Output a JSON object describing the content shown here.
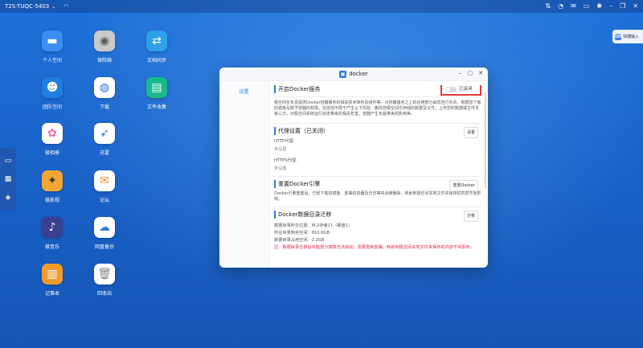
{
  "topbar": {
    "device": "T2S-TUQC-5403",
    "icons": [
      "sort-icon",
      "speed-icon",
      "mail-icon",
      "monitor-icon",
      "gear-icon",
      "minimize-icon",
      "restore-icon",
      "close-icon"
    ]
  },
  "desktop": {
    "icons": [
      {
        "label": "个人空间",
        "icon": "folder-icon",
        "color": "#3a8ff0"
      },
      {
        "label": "保险箱",
        "icon": "safe-icon",
        "color": "#c9c9c9"
      },
      {
        "label": "文档同步",
        "icon": "sync-icon",
        "color": "#2ea0e8"
      },
      {
        "label": "团队空间",
        "icon": "team-icon",
        "color": "#1f7fe0"
      },
      {
        "label": "下载",
        "icon": "globe-icon",
        "color": "#ffffff"
      },
      {
        "label": "文件收集",
        "icon": "collect-icon",
        "color": "#19b98b"
      },
      {
        "label": "极相册",
        "icon": "photos-icon",
        "color": "#ffffff"
      },
      {
        "label": "迅雷",
        "icon": "thunder-icon",
        "color": "#ffffff"
      },
      {
        "label": "极影视",
        "icon": "video-icon",
        "color": "#f2a636"
      },
      {
        "label": "论坛",
        "icon": "chat-icon",
        "color": "#ffffff"
      },
      {
        "label": "极音乐",
        "icon": "music-icon",
        "color": "#3a3f8f"
      },
      {
        "label": "网盘备份",
        "icon": "cloud-icon",
        "color": "#ffffff"
      },
      {
        "label": "记事本",
        "icon": "notes-icon",
        "color": "#f29b2f"
      },
      {
        "label": "回收站",
        "icon": "trash-icon",
        "color": "#ffffff"
      }
    ]
  },
  "quick": {
    "label": "快捷输入"
  },
  "window": {
    "title": "docker",
    "sidebar_item": "设置",
    "docker_service": {
      "title": "开启Docker服务",
      "toggle_label": "已关闭",
      "enabled": false,
      "description": "极空间仅负责提供Docker容器服务的相关技术架构及组件等。对容器服务之上的应用部分由您自行负责。根据您下载的镜像及赋予容器的权限，包括但不限于产生以下风险：删改您极空间中存储的数据及文件，上传您的数据或文件至第三方，对极空间系统运行状态带来的相关危害。容器产生负载带来的影响等。"
    },
    "proxy": {
      "title": "代理设置（已关闭）",
      "button": "设置",
      "http_label": "HTTP代理:",
      "http_value": "未设置",
      "https_label": "HTTPS代理:",
      "https_value": "未设置"
    },
    "reset": {
      "title": "重置Docker引擎",
      "button": "重置Docker",
      "description": "Docker引擎重置后，已经下载的镜像、部署的容器及日志等将会被删除，映射到极空间本地文件夹保存的内容不受影响。"
    },
    "migrate": {
      "title": "Docker数据目录迁移",
      "button": "迁移",
      "location": "数据目录所在位置：M.2存储11（硬盘1）",
      "free": "所在目录剩余空间：810.6GB",
      "used": "数据目录占用空间：2.2GB",
      "warning": "注：数据目录迁移后可能部分镜像无法启动，需要重新部署，映射到极空间本地文件夹保存的内容不受影响。"
    }
  }
}
